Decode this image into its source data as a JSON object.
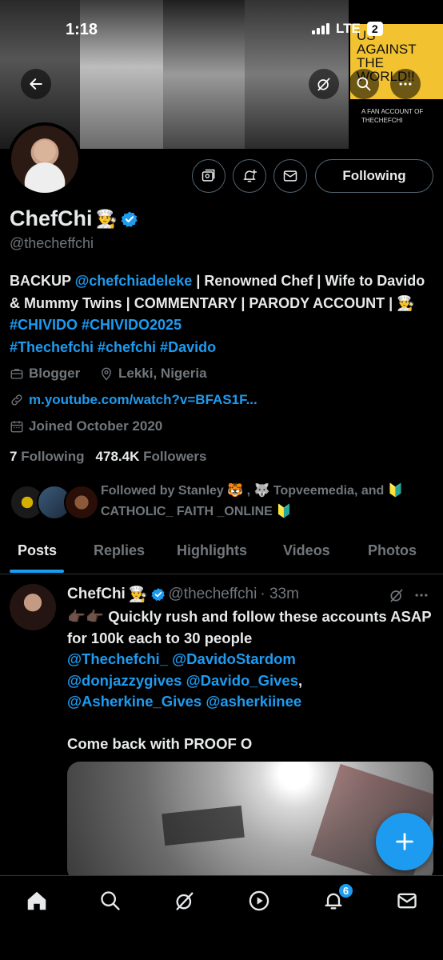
{
  "status_bar": {
    "time": "1:18",
    "network": "LTE",
    "battery": "2"
  },
  "banner": {
    "fan_title": "US AGAINST THE WORLD!!",
    "fan_subtitle": "A FAN ACCOUNT OF THECHEFCHI"
  },
  "header_icons": {
    "back": "back-arrow-icon",
    "grok": "grok-icon",
    "search": "search-icon",
    "more": "more-icon"
  },
  "profile": {
    "name": "ChefChi",
    "name_emoji": "👨‍🍳",
    "handle": "@thecheffchi",
    "follow_button": "Following",
    "bio": {
      "p1": "BACKUP ",
      "mention": "@chefchiadeleke",
      "p2": " | Renowned Chef | Wife to Davido & Mummy Twins | COMMENTARY | PARODY ACCOUNT | 👨‍🍳 ",
      "tags1": "#CHIVIDO #CHIVIDO2025",
      "tags2": "#Thechefchi #chefchi #Davido"
    },
    "category": "Blogger",
    "location": "Lekki, Nigeria",
    "link": "m.youtube.com/watch?v=BFAS1F...",
    "joined": "Joined October 2020",
    "following_count": "7",
    "following_label": "Following",
    "followers_count": "478.4K",
    "followers_label": "Followers",
    "followed_by": "Followed by Stanley 🐯 , 🐺 Topveemedia, and 🔰 CATHOLIC_ FAITH _ONLINE 🔰"
  },
  "tabs": [
    {
      "label": "Posts"
    },
    {
      "label": "Replies"
    },
    {
      "label": "Highlights"
    },
    {
      "label": "Videos"
    },
    {
      "label": "Photos"
    }
  ],
  "post": {
    "name": "ChefChi",
    "emoji": "👨‍🍳",
    "handle": "@thecheffchi",
    "time": "· 33m",
    "line1": "👉🏿👉🏿 Quickly rush and follow these accounts ASAP for 100k each to 30 people",
    "mentions1": "@Thechefchi_ @DavidoStardom",
    "mentions2a": "@donjazzygives @Davido_Gives",
    "mentions2b": ",",
    "mentions3": "@Asherkine_Gives @asherkiinee",
    "line2": "Come back with PROOF O"
  },
  "nav": {
    "notifications_badge": "6"
  },
  "colors": {
    "accent": "#1d9bf0",
    "muted": "#71767b",
    "text": "#e7e9ea"
  }
}
